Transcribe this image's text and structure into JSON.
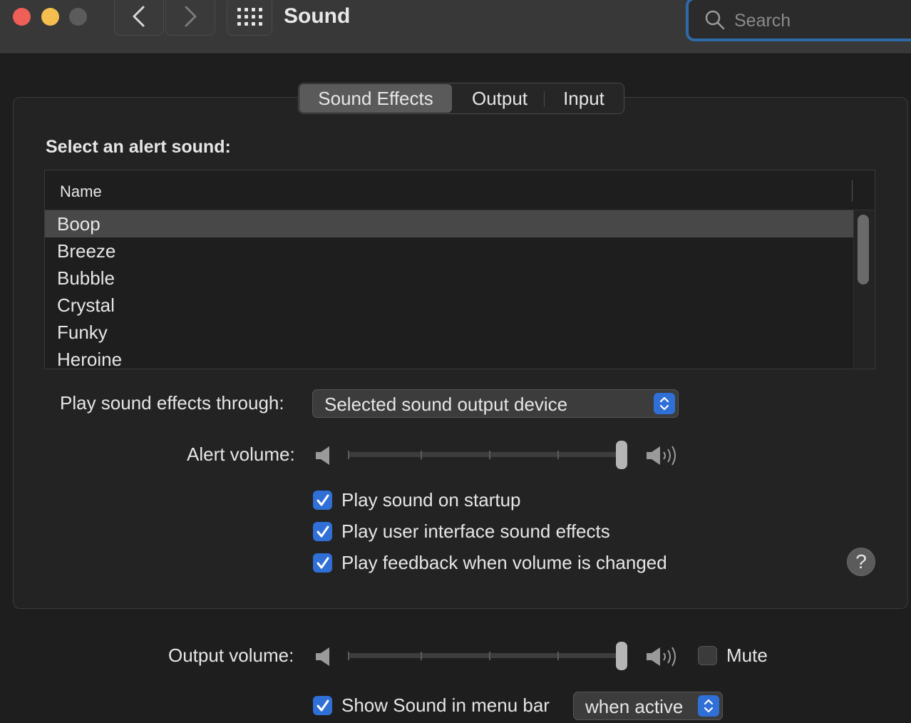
{
  "window": {
    "title": "Sound"
  },
  "toolbar": {
    "search_placeholder": "Search"
  },
  "tabs": [
    {
      "label": "Sound Effects",
      "selected": true
    },
    {
      "label": "Output",
      "selected": false
    },
    {
      "label": "Input",
      "selected": false
    }
  ],
  "alert_section": {
    "title": "Select an alert sound:",
    "column_header": "Name",
    "sounds": [
      "Boop",
      "Breeze",
      "Bubble",
      "Crystal",
      "Funky",
      "Heroine"
    ],
    "selected_sound": "Boop"
  },
  "play_through": {
    "label": "Play sound effects through:",
    "value": "Selected sound output device"
  },
  "alert_volume": {
    "label": "Alert volume:",
    "level": 1.0
  },
  "checkboxes": [
    {
      "label": "Play sound on startup",
      "checked": true
    },
    {
      "label": "Play user interface sound effects",
      "checked": true
    },
    {
      "label": "Play feedback when volume is changed",
      "checked": true
    }
  ],
  "help": {
    "label": "?"
  },
  "output_volume": {
    "label": "Output volume:",
    "level": 1.0
  },
  "mute": {
    "label": "Mute",
    "checked": false
  },
  "menu_bar": {
    "label": "Show Sound in menu bar",
    "checked": true,
    "option": "when active"
  },
  "colors": {
    "accent": "#2f6fd6",
    "window_bg": "#1e1e1e",
    "titlebar_bg": "#383838",
    "selection": "#484848"
  },
  "icons": [
    "back-icon",
    "forward-icon",
    "grid-icon",
    "search-icon",
    "speaker-low-icon",
    "speaker-high-icon",
    "checkmark-icon",
    "stepper-icon"
  ]
}
